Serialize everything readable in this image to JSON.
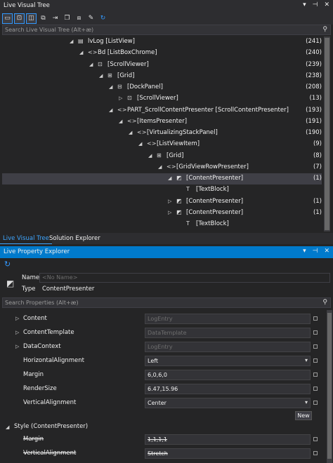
{
  "tree_panel": {
    "title": "Live Visual Tree",
    "title_buttons": [
      "▾",
      "⊣",
      "✕"
    ],
    "search_placeholder": "Search Live Visual Tree (Alt+æ)",
    "rows": [
      {
        "label": "lvLog [ListView]",
        "count": "(241)",
        "icon": "listview-icon",
        "glyph": "▤",
        "arrow": "◢"
      },
      {
        "label": "Bd [ListBoxChrome]",
        "count": "(240)",
        "icon": "code-icon",
        "glyph": "<>",
        "arrow": "◢"
      },
      {
        "label": "[ScrollViewer]",
        "count": "(239)",
        "icon": "scrollviewer-icon",
        "glyph": "⊡",
        "arrow": "◢"
      },
      {
        "label": "[Grid]",
        "count": "(238)",
        "icon": "grid-icon",
        "glyph": "⊞",
        "arrow": "◢"
      },
      {
        "label": "[DockPanel]",
        "count": "(208)",
        "icon": "dockpanel-icon",
        "glyph": "⊟",
        "arrow": "◢"
      },
      {
        "label": "[ScrollViewer]",
        "count": "(13)",
        "icon": "scrollviewer-icon",
        "glyph": "⊡",
        "arrow": "▷"
      },
      {
        "label": "PART_ScrollContentPresenter [ScrollContentPresenter]",
        "count": "(193)",
        "icon": "code-icon",
        "glyph": "<>",
        "arrow": "◢"
      },
      {
        "label": "[ItemsPresenter]",
        "count": "(191)",
        "icon": "code-icon",
        "glyph": "<>",
        "arrow": "◢"
      },
      {
        "label": "[VirtualizingStackPanel]",
        "count": "(190)",
        "icon": "code-icon",
        "glyph": "<>",
        "arrow": "◢"
      },
      {
        "label": "[ListViewItem]",
        "count": "(9)",
        "icon": "code-icon",
        "glyph": "<>",
        "arrow": "◢"
      },
      {
        "label": "[Grid]",
        "count": "(8)",
        "icon": "grid-icon",
        "glyph": "⊞",
        "arrow": "◢"
      },
      {
        "label": "[GridViewRowPresenter]",
        "count": "(7)",
        "icon": "code-icon",
        "glyph": "<>",
        "arrow": "◢"
      },
      {
        "label": "[ContentPresenter]",
        "count": "(1)",
        "icon": "contentpresenter-icon",
        "glyph": "◩",
        "arrow": "◢"
      },
      {
        "label": "[TextBlock]",
        "count": "",
        "icon": "textblock-icon",
        "glyph": "T",
        "arrow": ""
      },
      {
        "label": "[ContentPresenter]",
        "count": "(1)",
        "icon": "contentpresenter-icon",
        "glyph": "◩",
        "arrow": "▷"
      },
      {
        "label": "[ContentPresenter]",
        "count": "(1)",
        "icon": "contentpresenter-icon",
        "glyph": "◩",
        "arrow": "▷"
      },
      {
        "label": "[TextBlock]",
        "count": "",
        "icon": "textblock-icon",
        "glyph": "T",
        "arrow": ""
      }
    ],
    "selected_index": 12
  },
  "tabs": {
    "live_visual_tree": "Live Visual Tree",
    "solution_explorer": "Solution Explorer"
  },
  "property_panel": {
    "title": "Live Property Explorer",
    "title_buttons": [
      "▾",
      "⊣",
      "✕"
    ],
    "name_label": "Name",
    "name_placeholder": "<No Name>",
    "type_label": "Type",
    "type_value": "ContentPresenter",
    "search_placeholder": "Search Properties (Alt+æ)",
    "properties": [
      {
        "name": "Content",
        "value": "LogEntry",
        "dim": true,
        "expandable": true,
        "combo": false
      },
      {
        "name": "ContentTemplate",
        "value": "DataTemplate",
        "dim": true,
        "expandable": true,
        "combo": false
      },
      {
        "name": "DataContext",
        "value": "LogEntry",
        "dim": true,
        "expandable": true,
        "combo": false
      },
      {
        "name": "HorizontalAlignment",
        "value": "Left",
        "dim": false,
        "expandable": false,
        "combo": true
      },
      {
        "name": "Margin",
        "value": "6,0,6,0",
        "dim": false,
        "expandable": false,
        "combo": false
      },
      {
        "name": "RenderSize",
        "value": "6.47,15.96",
        "dim": false,
        "expandable": false,
        "combo": false
      },
      {
        "name": "VerticalAlignment",
        "value": "Center",
        "dim": false,
        "expandable": false,
        "combo": true
      }
    ],
    "new_button": "New",
    "style_section": "Style (ContentPresenter)",
    "style_properties": [
      {
        "name": "Margin",
        "value": "1,1,1,1"
      },
      {
        "name": "VerticalAlignment",
        "value": "Stretch"
      }
    ]
  },
  "colors": {
    "accent": "#007acc",
    "background": "#252526",
    "selection": "#3f3f46"
  }
}
